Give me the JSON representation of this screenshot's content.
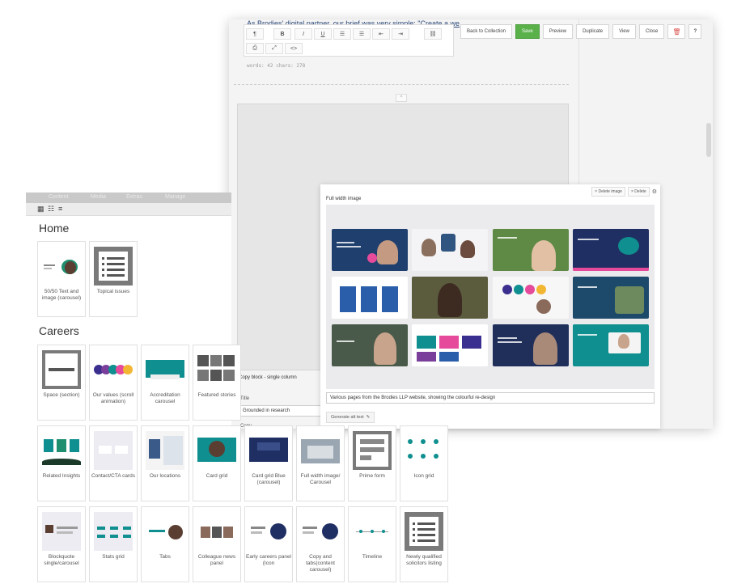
{
  "editor": {
    "intro_text": "As Brodies' digital partner, our brief was very simple: \"Create a we",
    "rte_buttons_row1": [
      "¶",
      "B",
      "I",
      "U",
      "☰",
      "☰",
      "⇤",
      "⇥",
      "⛓"
    ],
    "rte_buttons_row2": [
      "⎙",
      "⤢",
      "<>"
    ],
    "word_count": "words: 42   chars: 278",
    "copy_block_title": "Copy block - single column",
    "title_label": "Title",
    "title_value": "Grounded in research",
    "copy_label": "Copy"
  },
  "actions": {
    "back": "Back to Collection",
    "save": "Save",
    "preview": "Preview",
    "duplicate": "Duplicate",
    "view": "View",
    "close": "Close",
    "delete_icon": "trash-icon",
    "help_icon": "help-icon"
  },
  "colors": {
    "save_green": "#5ab14a",
    "brand_navy": "#1f3f6e",
    "brand_teal": "#0f8f8f",
    "brand_purple": "#3a2f8f"
  },
  "fullwidth": {
    "title": "Full width image",
    "delete_image": "× Delete image",
    "delete": "× Delete",
    "caption": "Various pages from the Brodies LLP website, showing the colourful re-design",
    "generate_alt": "Generate alt text"
  },
  "picker": {
    "nav": [
      "Content",
      "Media",
      "Extras",
      "Manage"
    ],
    "home_title": "Home",
    "home_cards": [
      {
        "label": "50/50 Text and image (carousel)"
      },
      {
        "label": "Topical issues"
      }
    ],
    "careers_title": "Careers",
    "careers_cards": [
      {
        "label": "Space (section)"
      },
      {
        "label": "Our values (scroll animation)"
      },
      {
        "label": "Accreditation carousel"
      },
      {
        "label": "Featured stories"
      },
      {
        "label": "Related Insights"
      },
      {
        "label": "Contact/CTA cards"
      },
      {
        "label": "Our locations"
      },
      {
        "label": "Card grid"
      },
      {
        "label": "Card grid Blue (carousel)"
      },
      {
        "label": "Full width image/ Carousel"
      },
      {
        "label": "Prime form"
      },
      {
        "label": "Icon grid"
      },
      {
        "label": "Blockquote single/carousel"
      },
      {
        "label": "Stats grid"
      },
      {
        "label": "Tabs"
      },
      {
        "label": "Colleague news panel"
      },
      {
        "label": "Early careers panel (Icon"
      },
      {
        "label": "Copy and tabs(content carousel)"
      },
      {
        "label": "Timeline"
      },
      {
        "label": "Newly qualified solicitors listing"
      }
    ]
  }
}
